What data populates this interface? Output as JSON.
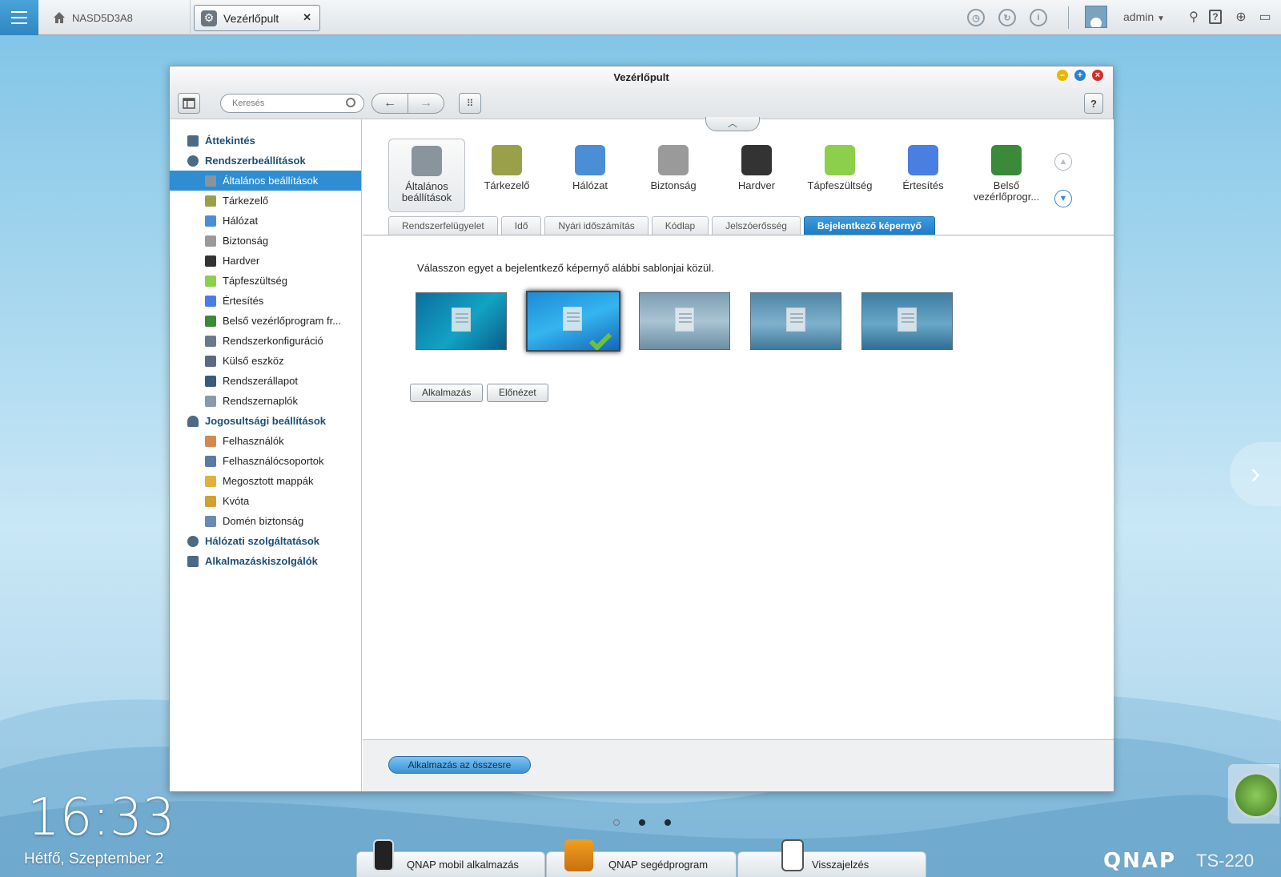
{
  "topbar": {
    "host": "NASD5D3A8",
    "app_tab": "Vezérlőpult",
    "user": "admin"
  },
  "window": {
    "title": "Vezérlőpult",
    "search_placeholder": "Keresés"
  },
  "sidebar": {
    "sections": [
      {
        "label": "Áttekintés"
      },
      {
        "label": "Rendszerbeállítások"
      },
      {
        "label": "Jogosultsági beállítások"
      },
      {
        "label": "Hálózati szolgáltatások"
      },
      {
        "label": "Alkalmazáskiszolgálók"
      }
    ],
    "system_items": [
      {
        "label": "Általános beállítások",
        "icon": "general-settings-icon",
        "active": true
      },
      {
        "label": "Tárkezelő",
        "icon": "storage-icon"
      },
      {
        "label": "Hálózat",
        "icon": "network-icon"
      },
      {
        "label": "Biztonság",
        "icon": "lock-icon"
      },
      {
        "label": "Hardver",
        "icon": "hardware-icon"
      },
      {
        "label": "Tápfeszültség",
        "icon": "power-bulb-icon"
      },
      {
        "label": "Értesítés",
        "icon": "notification-icon"
      },
      {
        "label": "Belső vezérlőprogram fr...",
        "icon": "firmware-icon"
      },
      {
        "label": "Rendszerkonfiguráció",
        "icon": "config-icon"
      },
      {
        "label": "Külső eszköz",
        "icon": "external-device-icon"
      },
      {
        "label": "Rendszerállapot",
        "icon": "system-status-icon"
      },
      {
        "label": "Rendszernaplók",
        "icon": "system-logs-icon"
      }
    ],
    "privilege_items": [
      {
        "label": "Felhasználók",
        "icon": "user-icon"
      },
      {
        "label": "Felhasználócsoportok",
        "icon": "user-groups-icon"
      },
      {
        "label": "Megosztott mappák",
        "icon": "shared-folder-icon"
      },
      {
        "label": "Kvóta",
        "icon": "quota-icon"
      },
      {
        "label": "Domén biztonság",
        "icon": "domain-security-icon"
      }
    ]
  },
  "categories": [
    {
      "label": "Általános beállítások",
      "icon": "general-settings-icon",
      "selected": true
    },
    {
      "label": "Tárkezelő",
      "icon": "storage-icon"
    },
    {
      "label": "Hálózat",
      "icon": "network-icon"
    },
    {
      "label": "Biztonság",
      "icon": "lock-icon"
    },
    {
      "label": "Hardver",
      "icon": "hardware-icon"
    },
    {
      "label": "Tápfeszültség",
      "icon": "power-bulb-icon"
    },
    {
      "label": "Értesítés",
      "icon": "notification-icon"
    },
    {
      "label": "Belső vezérlőprogr...",
      "icon": "firmware-icon"
    }
  ],
  "subtabs": [
    {
      "label": "Rendszerfelügyelet"
    },
    {
      "label": "Idő"
    },
    {
      "label": "Nyári időszámítás"
    },
    {
      "label": "Kódlap"
    },
    {
      "label": "Jelszóerősség"
    },
    {
      "label": "Bejelentkező képernyő",
      "active": true
    }
  ],
  "login_screen": {
    "instruction": "Válasszon egyet a bejelentkező képernyő alábbi sablonjai közül.",
    "selected_template": 2,
    "apply": "Alkalmazás",
    "preview": "Előnézet"
  },
  "footer": {
    "apply_all": "Alkalmazás az összesre"
  },
  "desktop": {
    "time": "16:33",
    "date": "Hétfő, Szeptember 2",
    "dock": [
      "QNAP mobil alkalmazás",
      "QNAP segédprogram",
      "Visszajelzés"
    ],
    "brand": "QNAP",
    "model": "TS-220"
  },
  "colors": {
    "accent": "#2e8ed1",
    "section_text": "#1c4f78"
  }
}
